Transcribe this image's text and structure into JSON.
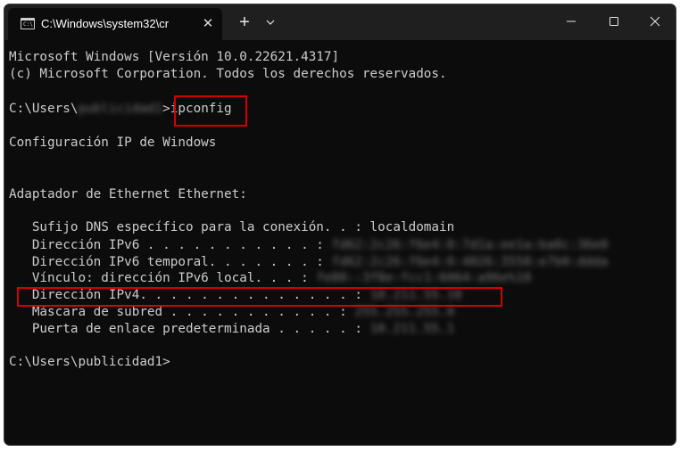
{
  "window": {
    "tab_title": "C:\\Windows\\system32\\cr",
    "tab_close": "✕",
    "new_tab": "+",
    "tab_menu_icon": "chevron-down-icon",
    "controls": [
      "minimize-icon",
      "maximize-icon",
      "close-icon"
    ]
  },
  "console": {
    "lines": [
      "Microsoft Windows [Versión 10.0.22621.4317]",
      "(c) Microsoft Corporation. Todos los derechos reservados.",
      "",
      "",
      "Configuración IP de Windows",
      "",
      "",
      "Adaptador de Ethernet Ethernet:",
      "",
      "   Sufijo DNS específico para la conexión. . : localdomain",
      "",
      "",
      "",
      "",
      "",
      "",
      "",
      "C:\\Users\\publicidad1>"
    ],
    "prompt_1": {
      "prefix": "C:\\Users\\",
      "redacted_user": "publicidad1",
      "suffix": ">",
      "command": "ipconfig"
    },
    "rows": [
      {
        "label": "   Dirección IPv6 . . . . . . . . . . . : ",
        "value": "fd62:2c26:f6e4:0:7d1a:ee1a:ba0c:36e0"
      },
      {
        "label": "   Dirección IPv6 temporal. . . . . . . : ",
        "value": "fd62:2c26:f6e4:0:4026:3558:e7b0:ddda"
      },
      {
        "label": "   Vínculo: dirección IPv6 local. . . : ",
        "value": "fe80::3f8e:fcc1:6064:a96e%10"
      },
      {
        "label": "   Dirección IPv4. . . . . . . . . . . . . . : ",
        "value": "10.211.55.10"
      },
      {
        "label": "   Máscara de subred . . . . . . . . . . . : ",
        "value": "255.255.255.0"
      },
      {
        "label": "   Puerta de enlace predeterminada . . . . . : ",
        "value": "10.211.55.1"
      }
    ]
  },
  "annotations": {
    "highlight_color": "#d40000"
  }
}
